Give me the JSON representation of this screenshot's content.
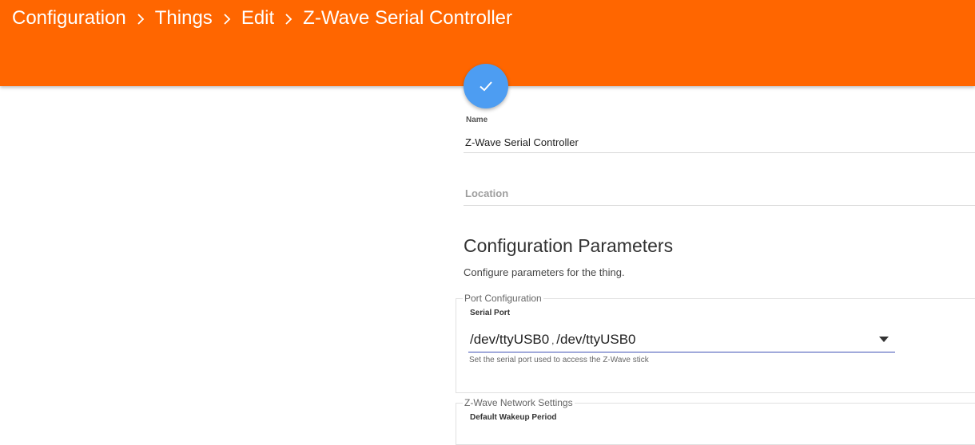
{
  "colors": {
    "header_bg": "#ff6600",
    "fab_bg": "#4d9df2",
    "select_underline": "#3f51b5"
  },
  "breadcrumb": {
    "items": [
      "Configuration",
      "Things",
      "Edit",
      "Z-Wave Serial Controller"
    ],
    "separator_icon": "chevron-right-icon"
  },
  "fab": {
    "icon": "check-icon"
  },
  "thing": {
    "name_label": "Name",
    "name_value": "Z-Wave Serial Controller",
    "location_placeholder": "Location"
  },
  "config": {
    "title": "Configuration Parameters",
    "description": "Configure parameters for the thing.",
    "groups": [
      {
        "legend": "Port Configuration",
        "param_label": "Serial Port",
        "selected_value": "/dev/ttyUSB0",
        "selected_separator": ",",
        "selected_value_secondary": "/dev/ttyUSB0",
        "help": "Set the serial port used to access the Z-Wave stick"
      },
      {
        "legend": "Z-Wave Network Settings",
        "param_label": "Default Wakeup Period"
      }
    ]
  }
}
